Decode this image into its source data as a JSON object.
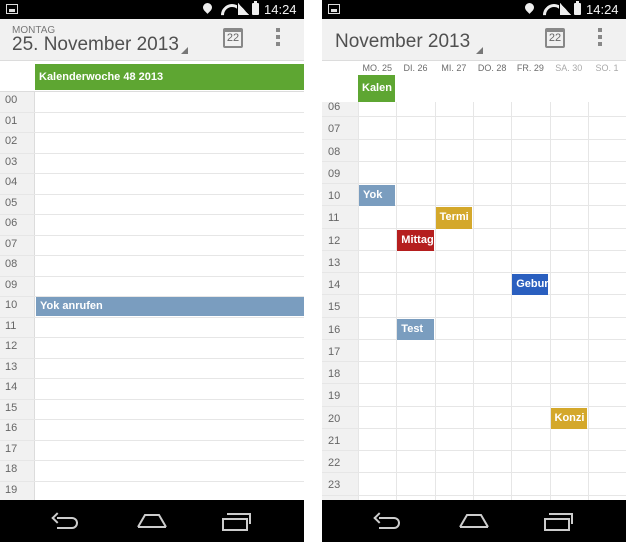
{
  "status_bar": {
    "time": "14:24"
  },
  "day_view": {
    "weekday_label": "MONTAG",
    "date_title": "25. November 2013",
    "today_icon_day": "22",
    "allday_event": {
      "title": "Kalenderwoche 48 2013",
      "color": "#5ea632"
    },
    "hours": [
      "00",
      "01",
      "02",
      "03",
      "04",
      "05",
      "06",
      "07",
      "08",
      "09",
      "10",
      "11",
      "12",
      "13",
      "14",
      "15",
      "16",
      "17",
      "18",
      "19"
    ],
    "events": [
      {
        "title": "Yok anrufen",
        "color": "#7a9dbf"
      }
    ]
  },
  "week_view": {
    "title": "November 2013",
    "today_icon_day": "22",
    "days": [
      "MO. 25",
      "DI. 26",
      "MI. 27",
      "DO. 28",
      "FR. 29",
      "SA. 30",
      "SO. 1"
    ],
    "hours": [
      "06",
      "07",
      "08",
      "09",
      "10",
      "11",
      "12",
      "13",
      "14",
      "15",
      "16",
      "17",
      "18",
      "19",
      "20",
      "21",
      "22",
      "23"
    ],
    "allday_event": {
      "title": "Kalen",
      "color": "#5ea632"
    },
    "events": [
      {
        "title": "Yok",
        "color": "#7a9dbf"
      },
      {
        "title": "Termi",
        "color": "#d4a82b"
      },
      {
        "title": "Mittag",
        "color": "#b51e1e"
      },
      {
        "title": "Gebur",
        "color": "#2a5fbf"
      },
      {
        "title": "Test",
        "color": "#7a9dbf"
      },
      {
        "title": "Konzi",
        "color": "#d4a82b"
      }
    ]
  },
  "icons": [
    "notification-icon",
    "location-icon",
    "wifi-icon",
    "signal-icon",
    "battery-icon",
    "calendar-today-icon",
    "overflow-menu-icon",
    "back-icon",
    "home-icon",
    "recent-apps-icon"
  ]
}
